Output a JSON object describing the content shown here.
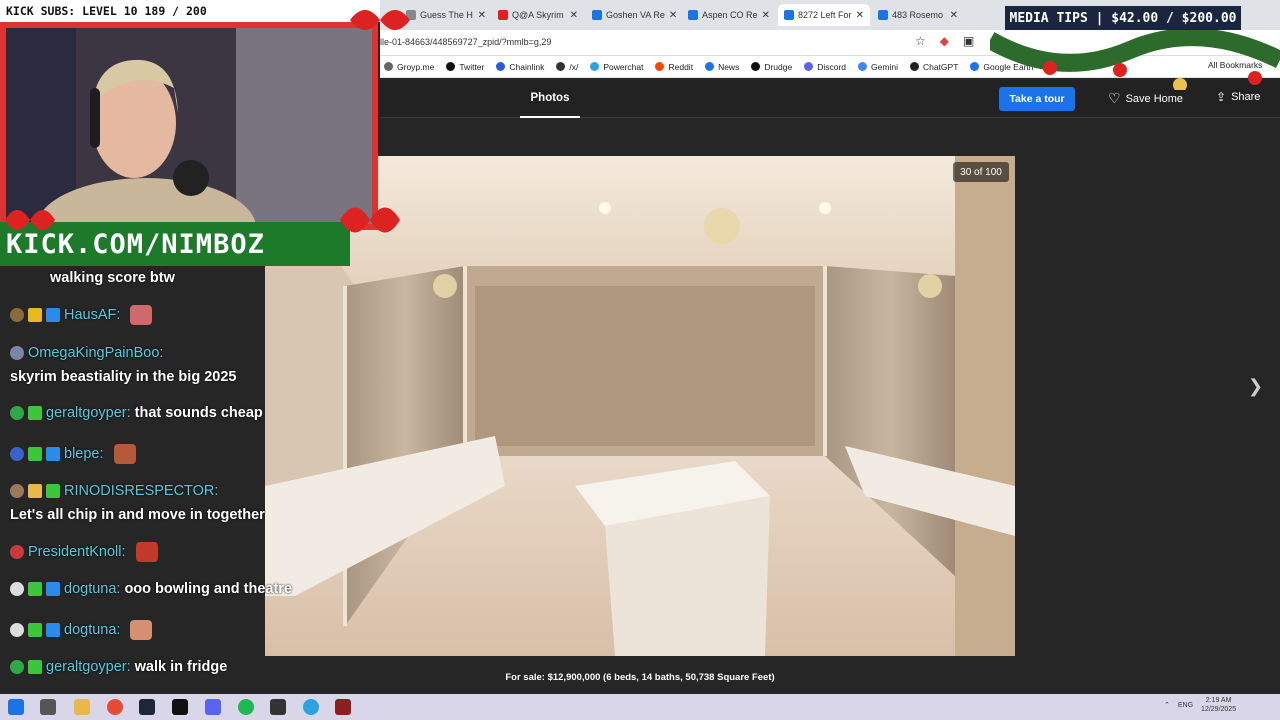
{
  "stream": {
    "subs_text": "KICK SUBS: LEVEL 10 189 / 200",
    "kick_url": "KICK.COM/NIMBOZ",
    "media_tips": "MEDIA TIPS | $42.00 / $200.00"
  },
  "browser": {
    "tabs": [
      {
        "label": "Guess The H"
      },
      {
        "label": "Q@A Skyrim"
      },
      {
        "label": "Goshen VA Re"
      },
      {
        "label": "Aspen CO Re"
      },
      {
        "label": "8272 Left For",
        "active": true
      },
      {
        "label": "483 Rosemo"
      }
    ],
    "url": "lle-01-84663/448569727_zpid/?mmlb=g,29",
    "bookmarks": [
      "Groyp.me",
      "Twitter",
      "Chainlink",
      "/x/",
      "Powerchat",
      "Reddit",
      "News",
      "Drudge",
      "Discord",
      "Gemini",
      "ChatGPT",
      "Google Earth"
    ],
    "all_bookmarks": "All Bookmarks"
  },
  "page": {
    "photos_tab": "Photos",
    "tour_button": "Take a tour",
    "save_home": "Save Home",
    "share": "Share",
    "photo_counter": "30 of 100",
    "caption": "For sale: $12,900,000 (6 beds, 14 baths, 50,738 Square Feet)"
  },
  "chat": {
    "messages": [
      {
        "user": "",
        "text": "walking score btw"
      },
      {
        "user": "HausAF:",
        "text": ""
      },
      {
        "user": "OmegaKingPainBoo:",
        "text": ""
      },
      {
        "user": "",
        "text": "skyrim beastiality in the big 2025"
      },
      {
        "user": "geraltgoyper:",
        "text": "that sounds cheap"
      },
      {
        "user": "blepe:",
        "text": ""
      },
      {
        "user": "RINODISRESPECTOR:",
        "text": ""
      },
      {
        "user": "",
        "text": "Let's all chip in and move in together"
      },
      {
        "user": "PresidentKnoll:",
        "text": ""
      },
      {
        "user": "dogtuna:",
        "text": "ooo bowling and theatre"
      },
      {
        "user": "dogtuna:",
        "text": ""
      },
      {
        "user": "geraltgoyper:",
        "text": "walk in fridge"
      }
    ]
  },
  "taskbar": {
    "lang": "ENG",
    "time": "2:19 AM",
    "date": "12/29/2025"
  },
  "colors": {
    "accent_blue": "#1a73e8",
    "username_cyan": "#5bc8e0",
    "kick_green": "#1d7a2a"
  }
}
